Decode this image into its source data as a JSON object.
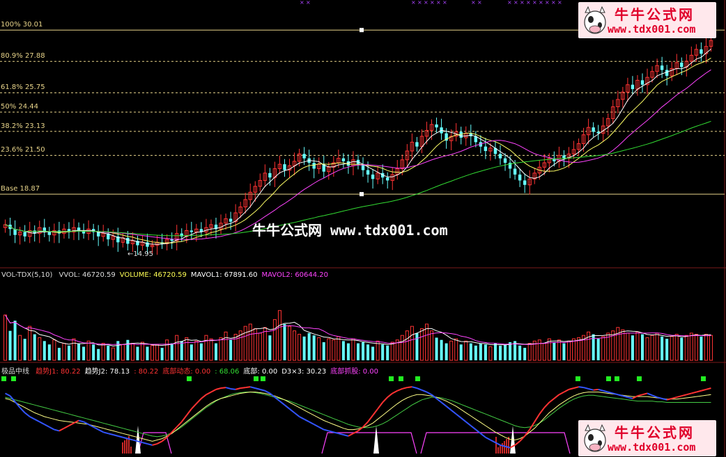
{
  "chart_data": [
    {
      "type": "candlestick",
      "panel": "price",
      "fib_levels": [
        {
          "label": "100% 30.01",
          "value": 30.01
        },
        {
          "label": "80.9% 27.88",
          "value": 27.88
        },
        {
          "label": "61.8% 25.75",
          "value": 25.75
        },
        {
          "label": "50% 24.44",
          "value": 24.44
        },
        {
          "label": "38.2% 23.13",
          "value": 23.13
        },
        {
          "label": "23.6% 21.50",
          "value": 21.5
        },
        {
          "label": "Base 18.87",
          "value": 18.87
        }
      ],
      "low_annotation": "14.95",
      "ylim": [
        14.2,
        31.2
      ],
      "closes": [
        16.8,
        16.5,
        16.1,
        16.3,
        16.0,
        16.4,
        16.2,
        16.6,
        16.3,
        16.1,
        16.4,
        16.2,
        16.5,
        16.3,
        16.6,
        16.4,
        16.2,
        16.5,
        16.3,
        16.0,
        16.2,
        15.8,
        16.0,
        15.6,
        15.9,
        15.5,
        15.7,
        15.4,
        15.6,
        15.3,
        15.4,
        15.6,
        15.5,
        15.8,
        15.7,
        16.2,
        16.0,
        16.4,
        16.3,
        16.5,
        16.3,
        16.6,
        16.8,
        16.5,
        16.9,
        17.2,
        17.0,
        17.6,
        18.0,
        18.5,
        19.0,
        19.4,
        19.8,
        20.3,
        20.0,
        20.6,
        20.9,
        20.5,
        20.8,
        21.1,
        21.6,
        21.3,
        21.0,
        20.6,
        20.9,
        20.4,
        20.7,
        21.0,
        21.3,
        21.1,
        20.8,
        21.2,
        20.9,
        20.5,
        20.2,
        19.9,
        20.3,
        20.0,
        19.8,
        20.2,
        20.6,
        21.2,
        21.8,
        22.4,
        22.1,
        22.8,
        23.2,
        23.6,
        23.4,
        23.0,
        22.5,
        22.8,
        23.1,
        22.7,
        23.0,
        22.8,
        22.4,
        22.1,
        21.8,
        22.0,
        21.6,
        21.3,
        21.0,
        20.6,
        20.2,
        19.8,
        19.5,
        19.9,
        20.3,
        20.7,
        21.0,
        21.3,
        21.1,
        21.5,
        21.3,
        21.6,
        21.9,
        22.3,
        22.9,
        23.4,
        23.1,
        23.0,
        23.5,
        24.0,
        24.8,
        25.3,
        25.8,
        26.3,
        26.0,
        26.6,
        26.3,
        26.8,
        27.2,
        27.6,
        27.3,
        26.9,
        27.4,
        27.8,
        27.5,
        27.9,
        28.3,
        28.7,
        28.4,
        28.9,
        29.3
      ],
      "series": [
        {
          "name": "MA5",
          "color": "#ffffff",
          "window": 5
        },
        {
          "name": "MA10",
          "color": "#ffff66",
          "window": 10
        },
        {
          "name": "MA20",
          "color": "#ff44ff",
          "window": 20
        },
        {
          "name": "MA60",
          "color": "#33dd33",
          "window": 60
        }
      ]
    },
    {
      "type": "bar",
      "panel": "volume",
      "indicator_name": "VOL-TDX(5,10)",
      "readouts": [
        {
          "label": "VVOL: 46720.59",
          "color": "#dddddd"
        },
        {
          "label": "VOLUME: 46720.59",
          "color": "#ffff55"
        },
        {
          "label": "MAVOL1: 67891.60",
          "color": "#ffffff"
        },
        {
          "label": "MAVOL2: 60644.20",
          "color": "#ff44ff"
        }
      ],
      "ylim": [
        0,
        140000
      ],
      "values": [
        80000,
        52000,
        70000,
        44000,
        38000,
        60000,
        46000,
        40000,
        34000,
        28000,
        36000,
        22000,
        30000,
        26000,
        38000,
        30000,
        24000,
        34000,
        28000,
        20000,
        30000,
        26000,
        22000,
        34000,
        28000,
        36000,
        30000,
        24000,
        32000,
        24000,
        26000,
        28000,
        22000,
        36000,
        30000,
        44000,
        34000,
        40000,
        28000,
        34000,
        30000,
        44000,
        38000,
        30000,
        40000,
        50000,
        36000,
        46000,
        52000,
        60000,
        64000,
        56000,
        48000,
        58000,
        44000,
        72000,
        88000,
        64000,
        60000,
        52000,
        46000,
        42000,
        48000,
        44000,
        40000,
        32000,
        38000,
        36000,
        42000,
        34000,
        30000,
        38000,
        30000,
        32000,
        28000,
        24000,
        34000,
        28000,
        26000,
        32000,
        36000,
        44000,
        52000,
        60000,
        48000,
        56000,
        64000,
        52000,
        40000,
        36000,
        30000,
        34000,
        38000,
        28000,
        34000,
        30000,
        26000,
        30000,
        28000,
        24000,
        30000,
        26000,
        28000,
        32000,
        34000,
        26000,
        22000,
        30000,
        34000,
        36000,
        30000,
        38000,
        32000,
        36000,
        30000,
        34000,
        38000,
        40000,
        44000,
        50000,
        46000,
        38000,
        42000,
        48000,
        52000,
        58000,
        54000,
        48000,
        44000,
        50000,
        46000,
        40000,
        44000,
        48000,
        42000,
        38000,
        42000,
        46000,
        40000,
        44000,
        48000,
        46000,
        42000,
        46000,
        44000
      ],
      "up_color": "#ff3333",
      "down_color": "#66ffff"
    },
    {
      "type": "line",
      "panel": "indicator",
      "indicator_name": "极品中线",
      "readouts": [
        {
          "label": "趋势J1: 80.22",
          "color": "#ff3333"
        },
        {
          "label": "趋势J2: 78.13",
          "color": "#ffffff"
        },
        {
          "label": ": 80.22",
          "color": "#ff3333"
        },
        {
          "label": "底部动态: 0.00",
          "color": "#ff3333"
        },
        {
          "label": ": 68.06",
          "color": "#33dd33"
        },
        {
          "label": "底部: 0.00",
          "color": "#ffffff"
        },
        {
          "label": "D3×3: 30.23",
          "color": "#ffffff"
        },
        {
          "label": "底部抓股: 0.00",
          "color": "#ff44ff"
        }
      ],
      "ylim": [
        -5,
        110
      ],
      "j1": [
        88,
        84,
        75,
        66,
        58,
        52,
        48,
        44,
        40,
        36,
        32,
        30,
        34,
        38,
        42,
        46,
        44,
        40,
        36,
        32,
        28,
        26,
        24,
        22,
        20,
        18,
        16,
        14,
        12,
        10,
        8,
        10,
        14,
        20,
        28,
        36,
        44,
        54,
        64,
        72,
        80,
        86,
        90,
        94,
        96,
        97,
        95,
        94,
        96,
        97,
        98,
        96,
        94,
        92,
        88,
        82,
        76,
        70,
        64,
        58,
        52,
        48,
        44,
        40,
        36,
        32,
        30,
        28,
        26,
        24,
        22,
        26,
        30,
        36,
        44,
        54,
        64,
        74,
        82,
        88,
        92,
        95,
        97,
        98,
        96,
        93,
        90,
        86,
        80,
        74,
        68,
        62,
        56,
        50,
        44,
        38,
        32,
        26,
        20,
        16,
        12,
        8,
        6,
        4,
        8,
        14,
        22,
        32,
        44,
        56,
        66,
        74,
        80,
        86,
        90,
        94,
        96,
        98,
        97,
        95,
        93,
        94,
        92,
        90,
        88,
        86,
        84,
        82,
        80,
        84,
        86,
        88,
        85,
        82,
        80,
        78,
        80,
        82,
        84,
        86,
        88,
        90,
        92,
        94,
        96
      ],
      "j2": [
        80,
        78,
        74,
        70,
        66,
        62,
        58,
        55,
        52,
        50,
        48,
        46,
        45,
        44,
        43,
        42,
        41,
        40,
        38,
        36,
        34,
        32,
        30,
        28,
        26,
        24,
        22,
        20,
        18,
        16,
        14,
        16,
        18,
        22,
        26,
        32,
        38,
        44,
        50,
        56,
        62,
        68,
        73,
        77,
        80,
        82,
        84,
        86,
        88,
        89,
        90,
        90,
        89,
        88,
        86,
        84,
        81,
        78,
        74,
        70,
        66,
        62,
        58,
        54,
        50,
        46,
        43,
        40,
        37,
        34,
        32,
        32,
        33,
        35,
        38,
        42,
        48,
        54,
        60,
        66,
        72,
        77,
        81,
        84,
        86,
        86,
        85,
        84,
        82,
        79,
        76,
        72,
        68,
        63,
        58,
        53,
        48,
        43,
        38,
        33,
        28,
        24,
        20,
        17,
        16,
        18,
        22,
        28,
        34,
        42,
        50,
        58,
        64,
        70,
        75,
        80,
        84,
        87,
        89,
        90,
        90,
        90,
        89,
        88,
        87,
        86,
        85,
        84,
        83,
        83,
        83,
        83,
        82,
        81,
        80,
        79,
        79,
        79,
        80,
        81,
        82,
        83,
        84,
        85,
        86
      ],
      "j1_color": "#ff3333",
      "j1_down_color": "#3355ff",
      "j2_color": "#ffff88",
      "d3_color": "#44cc44",
      "d3": [
        82,
        80,
        78,
        76,
        74,
        72,
        70,
        68,
        66,
        64,
        62,
        60,
        58,
        56,
        54,
        52,
        50,
        48,
        46,
        44,
        42,
        40,
        38,
        36,
        34,
        32,
        30,
        28,
        26,
        24,
        22,
        21,
        22,
        24,
        27,
        31,
        36,
        42,
        48,
        54,
        60,
        66,
        71,
        76,
        80,
        83,
        86,
        88,
        89,
        90,
        90,
        89,
        88,
        86,
        84,
        82,
        80,
        78,
        76,
        73,
        70,
        67,
        64,
        61,
        58,
        55,
        52,
        49,
        46,
        43,
        40,
        38,
        36,
        35,
        35,
        36,
        38,
        41,
        45,
        50,
        55,
        60,
        65,
        70,
        74,
        78,
        80,
        82,
        82,
        81,
        79,
        77,
        74,
        71,
        68,
        65,
        62,
        59,
        56,
        53,
        50,
        47,
        44,
        41,
        38,
        36,
        35,
        36,
        38,
        42,
        47,
        53,
        59,
        65,
        70,
        75,
        79,
        82,
        84,
        85,
        85,
        84,
        83,
        82,
        81,
        80,
        79,
        78,
        77,
        76,
        76,
        76,
        76,
        75,
        75,
        74,
        74,
        74,
        74,
        74,
        74,
        74,
        74,
        74,
        74
      ]
    }
  ],
  "watermark_center": "牛牛公式网 www.tdx001.com",
  "badge": {
    "title": "牛牛公式网",
    "url": "www.tdx001.com"
  }
}
